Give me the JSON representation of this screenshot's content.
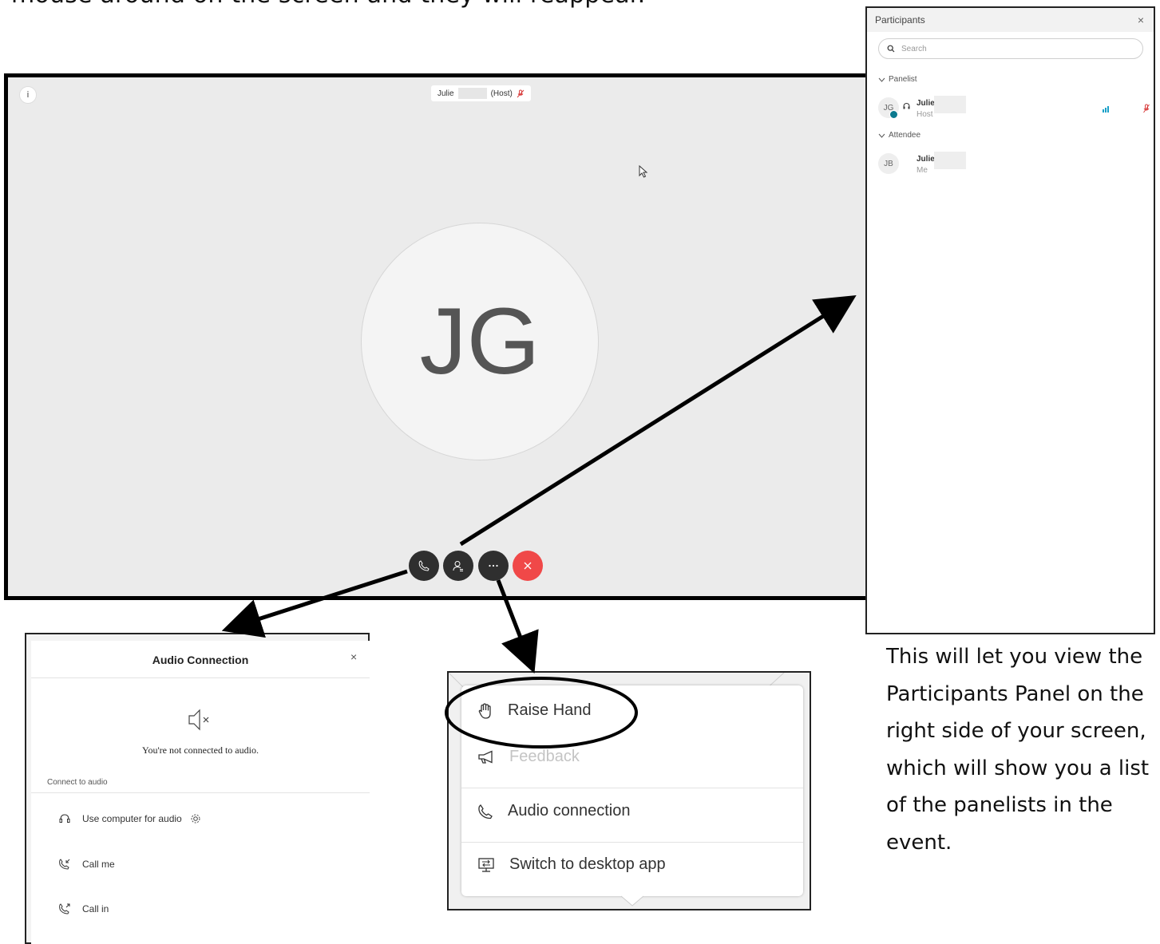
{
  "caption_top": "mouse around on the screen and they will reappear.",
  "video": {
    "info_glyph": "i",
    "name_tag": {
      "first": "Julie",
      "role": "(Host)"
    },
    "avatar_initials": "JG",
    "controls": [
      "phone-icon",
      "participants-icon",
      "more-icon",
      "close-icon"
    ]
  },
  "participants_panel": {
    "title": "Participants",
    "close": "×",
    "search_placeholder": "Search",
    "panelist_section": "Panelist",
    "panelist": {
      "initials": "JG",
      "name": "Julie",
      "role": "Host"
    },
    "attendee_section": "Attendee",
    "attendee": {
      "initials": "JB",
      "name": "Julie",
      "role": "Me"
    }
  },
  "audio_connection": {
    "title": "Audio Connection",
    "close": "×",
    "status": "You're not connected to audio.",
    "section_label": "Connect to audio",
    "options": [
      "Use computer for audio",
      "Call me",
      "Call in"
    ]
  },
  "more_menu": {
    "items": [
      {
        "label": "Raise Hand",
        "icon": "hand-icon",
        "enabled": true
      },
      {
        "label": "Feedback",
        "icon": "megaphone-icon",
        "enabled": false
      },
      {
        "label": "Audio connection",
        "icon": "phone-icon",
        "enabled": true
      },
      {
        "label": "Switch to desktop app",
        "icon": "desktop-icon",
        "enabled": true
      }
    ]
  },
  "explanation": "This will let you view the Participants Panel on the right side of your screen, which will show you a list of the panelists in the event.",
  "colors": {
    "end_call": "#f04848",
    "control_bg": "#2f2f2f",
    "muted_mic": "#d94040",
    "video_bg": "#ebebeb"
  }
}
